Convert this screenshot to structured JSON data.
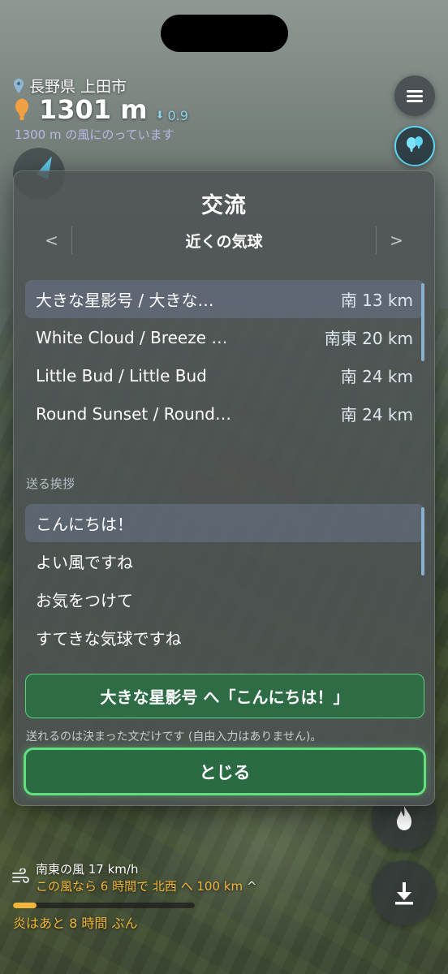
{
  "hud": {
    "location": "長野県 上田市",
    "altitude": "1301 m",
    "altitude_delta": "0.9",
    "wind_note": "1300 m の風にのっています"
  },
  "modal": {
    "title": "交流",
    "prev_label": "<",
    "next_label": ">",
    "tab_label": "近くの気球",
    "balloons": [
      {
        "name": "大きな星影号 / 大きな…",
        "distance": "南 13 km"
      },
      {
        "name": "White Cloud / Breeze …",
        "distance": "南東 20 km"
      },
      {
        "name": "Little Bud / Little Bud",
        "distance": "南 24 km"
      },
      {
        "name": "Round Sunset / Round…",
        "distance": "南 24 km"
      }
    ],
    "greeting_section_label": "送る挨拶",
    "greetings": [
      "こんにちは！",
      "よい風ですね",
      "お気をつけて",
      "すてきな気球ですね"
    ],
    "send_label": "大きな星影号 へ「こんにちは！」",
    "note": "送れるのは決まった文だけです (自由入力はありません)。",
    "close_label": "とじる"
  },
  "bottom": {
    "wind_line": "南東の風 17 km/h",
    "wind_forecast": "この風なら 6 時間で 北西 へ 100 km",
    "caret": "^",
    "fuel_fraction": 0.13,
    "fuel_text": "炎はあと 8 時間 ぶん"
  },
  "colors": {
    "accent_green": "#62e07e",
    "accent_cyan": "#5fd6f2",
    "fuel_orange": "#f0b53a"
  },
  "icons": [
    "pin-icon",
    "balloon-icon",
    "menu-icon",
    "chat-balloons-icon",
    "compass-icon",
    "wind-icon",
    "flame-icon",
    "download-icon"
  ]
}
